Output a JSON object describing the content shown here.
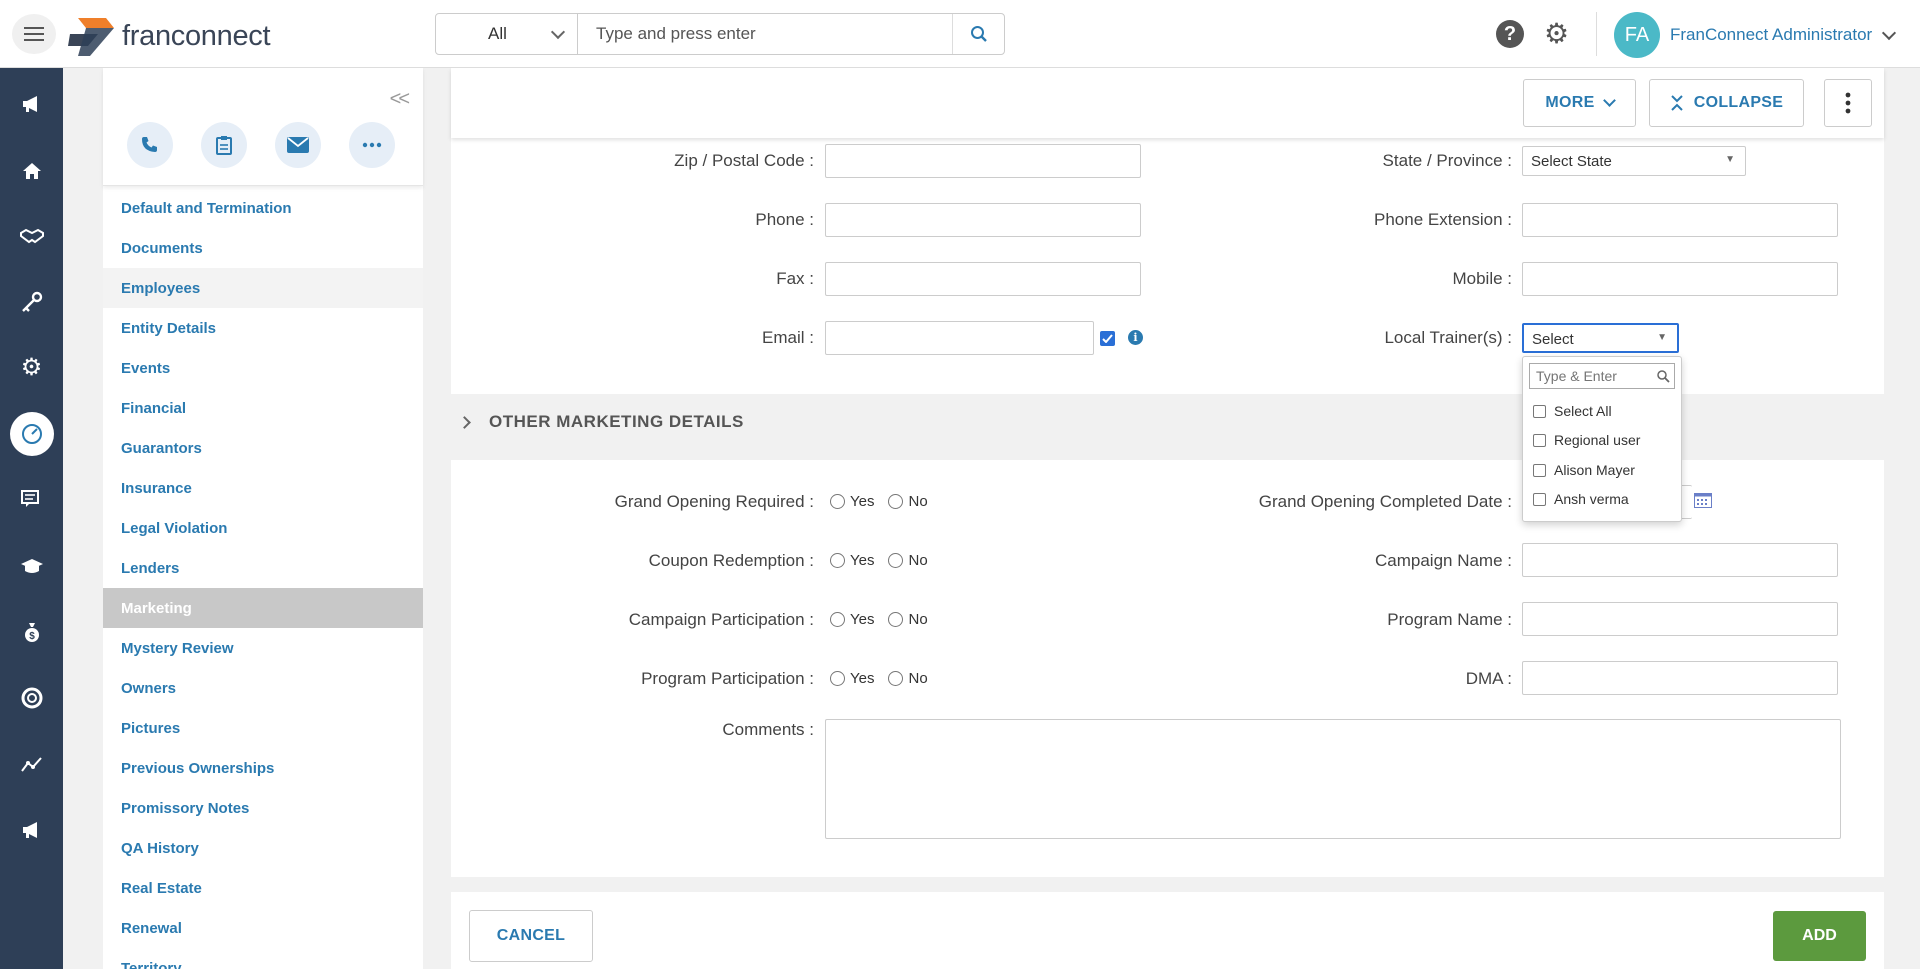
{
  "header": {
    "logo_light": "fran",
    "logo_bold": "connect",
    "search_scope": "All",
    "search_placeholder": "Type and press enter",
    "user_initials": "FA",
    "user_name": "FranConnect Administrator"
  },
  "sidebar": {
    "items": [
      {
        "label": "Default and Termination",
        "state": ""
      },
      {
        "label": "Documents",
        "state": ""
      },
      {
        "label": "Employees",
        "state": "hover"
      },
      {
        "label": "Entity Details",
        "state": ""
      },
      {
        "label": "Events",
        "state": ""
      },
      {
        "label": "Financial",
        "state": ""
      },
      {
        "label": "Guarantors",
        "state": ""
      },
      {
        "label": "Insurance",
        "state": ""
      },
      {
        "label": "Legal Violation",
        "state": ""
      },
      {
        "label": "Lenders",
        "state": ""
      },
      {
        "label": "Marketing",
        "state": "active"
      },
      {
        "label": "Mystery Review",
        "state": ""
      },
      {
        "label": "Owners",
        "state": ""
      },
      {
        "label": "Pictures",
        "state": ""
      },
      {
        "label": "Previous Ownerships",
        "state": ""
      },
      {
        "label": "Promissory Notes",
        "state": ""
      },
      {
        "label": "QA History",
        "state": ""
      },
      {
        "label": "Real Estate",
        "state": ""
      },
      {
        "label": "Renewal",
        "state": ""
      },
      {
        "label": "Territory",
        "state": ""
      }
    ]
  },
  "toolbar": {
    "more_label": "MORE",
    "collapse_label": "COLLAPSE"
  },
  "address_form": {
    "zip_label": "Zip / Postal Code :",
    "state_label": "State / Province :",
    "state_value": "Select State",
    "phone_label": "Phone :",
    "phone_ext_label": "Phone Extension :",
    "fax_label": "Fax :",
    "mobile_label": "Mobile :",
    "email_label": "Email :",
    "local_trainer_label": "Local Trainer(s) :",
    "local_trainer_value": "Select"
  },
  "trainer_dropdown": {
    "search_placeholder": "Type & Enter",
    "options": [
      "Select All",
      "Regional user",
      "Alison Mayer",
      "Ansh verma"
    ]
  },
  "marketing_section": {
    "title": "OTHER MARKETING DETAILS",
    "yes_label": "Yes",
    "no_label": "No",
    "grand_opening_label": "Grand Opening Required :",
    "grand_opening_date_label": "Grand Opening Completed Date :",
    "coupon_label": "Coupon Redemption :",
    "campaign_name_label": "Campaign Name :",
    "campaign_part_label": "Campaign Participation :",
    "program_name_label": "Program Name :",
    "program_part_label": "Program Participation :",
    "dma_label": "DMA :",
    "comments_label": "Comments :"
  },
  "footer": {
    "cancel_label": "CANCEL",
    "add_label": "ADD"
  },
  "colors": {
    "rail": "#2e3f57",
    "link": "#2a7ab0",
    "add_button": "#5c9a3e",
    "avatar": "#4bb9c7"
  }
}
